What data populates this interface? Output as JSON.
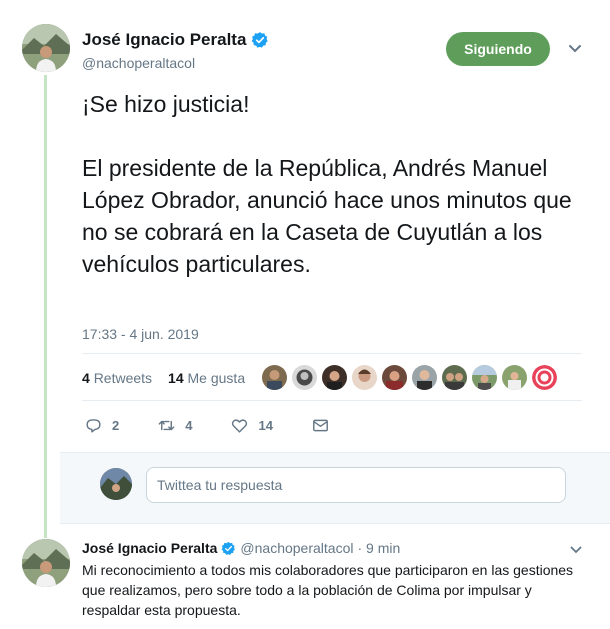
{
  "tweet": {
    "author_name": "José Ignacio Peralta",
    "author_handle": "@nachoperaltacol",
    "follow_label": "Siguiendo",
    "text": "¡Se hizo justicia!\n\nEl presidente de la República, Andrés Manuel López Obrador, anunció hace unos minutos que no se cobrará en la Caseta de Cuyutlán a los vehículos particulares.",
    "timestamp": "17:33 - 4 jun. 2019",
    "retweets_count": "4",
    "retweets_label": "Retweets",
    "likes_count": "14",
    "likes_label": "Me gusta",
    "actions": {
      "reply_count": "2",
      "retweet_count": "4",
      "like_count": "14"
    }
  },
  "reply_box": {
    "placeholder": "Twittea tu respuesta"
  },
  "reply_tweet": {
    "author_name": "José Ignacio Peralta",
    "author_handle": "@nachoperaltacol",
    "time": "· 9 min",
    "text": "Mi reconocimiento a todos mis colaboradores que participaron en las gestiones que realizamos, pero sobre todo a la población de Colima por impulsar y respaldar esta propuesta."
  },
  "colors": {
    "follow_button": "#5f9e5a",
    "verified": "#1da1f2",
    "thread_line": "#c4e5c3",
    "secondary_text": "#657786"
  },
  "icons": {
    "verified": "verified-badge-icon",
    "caret": "chevron-down-icon",
    "reply": "reply-icon",
    "retweet": "retweet-icon",
    "like": "heart-icon",
    "message": "envelope-icon"
  }
}
